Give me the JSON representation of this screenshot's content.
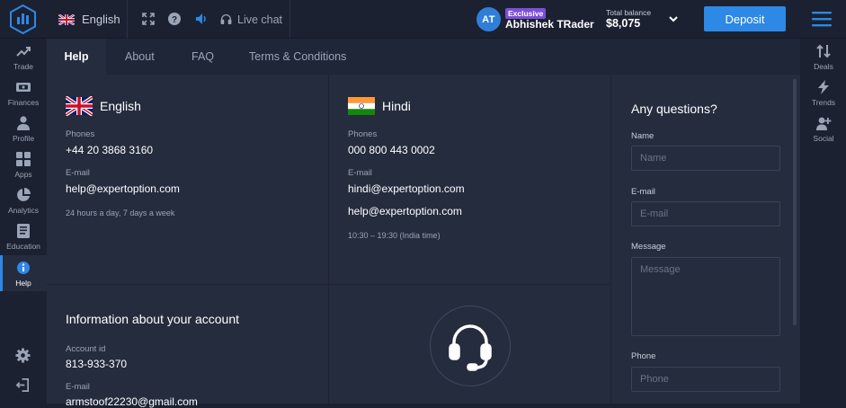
{
  "topbar": {
    "language": "English",
    "live_chat": "Live chat",
    "user": {
      "initials": "AT",
      "badge": "Exclusive",
      "name": "Abhishek TRader"
    },
    "balance": {
      "label": "Total balance",
      "value": "$8,075"
    },
    "deposit_label": "Deposit"
  },
  "left_nav": {
    "items": [
      {
        "label": "Trade",
        "icon": "trade-chart-icon"
      },
      {
        "label": "Finances",
        "icon": "wallet-icon"
      },
      {
        "label": "Profile",
        "icon": "user-icon"
      },
      {
        "label": "Apps",
        "icon": "apps-grid-icon"
      },
      {
        "label": "Analytics",
        "icon": "pie-chart-icon"
      },
      {
        "label": "Education",
        "icon": "book-icon"
      },
      {
        "label": "Help",
        "icon": "info-icon",
        "active": true
      }
    ]
  },
  "right_nav": {
    "items": [
      {
        "label": "Deals",
        "icon": "sort-arrows-icon"
      },
      {
        "label": "Trends",
        "icon": "lightning-icon"
      },
      {
        "label": "Social",
        "icon": "add-user-icon"
      }
    ]
  },
  "tabs": [
    "Help",
    "About",
    "FAQ",
    "Terms & Conditions"
  ],
  "support": {
    "english": {
      "title": "English",
      "phones_label": "Phones",
      "phone": "+44 20 3868 3160",
      "email_label": "E-mail",
      "email": "help@expertoption.com",
      "note": "24 hours a day, 7 days a week"
    },
    "hindi": {
      "title": "Hindi",
      "phones_label": "Phones",
      "phone": "000 800 443 0002",
      "email_label": "E-mail",
      "email": "hindi@expertoption.com",
      "email2": "help@expertoption.com",
      "note": "10:30 – 19:30 (India time)"
    }
  },
  "account": {
    "title": "Information about your account",
    "id_label": "Account id",
    "id": "813-933-370",
    "email_label": "E-mail",
    "email": "armstoof22230@gmail.com"
  },
  "form": {
    "title": "Any questions?",
    "name_label": "Name",
    "name_placeholder": "Name",
    "email_label": "E-mail",
    "email_placeholder": "E-mail",
    "message_label": "Message",
    "message_placeholder": "Message",
    "phone_label": "Phone",
    "phone_placeholder": "Phone"
  },
  "colors": {
    "background": "#1b2131",
    "panel": "#252c3e",
    "accent": "#2d88e6",
    "badge": "#7b4fd6"
  }
}
